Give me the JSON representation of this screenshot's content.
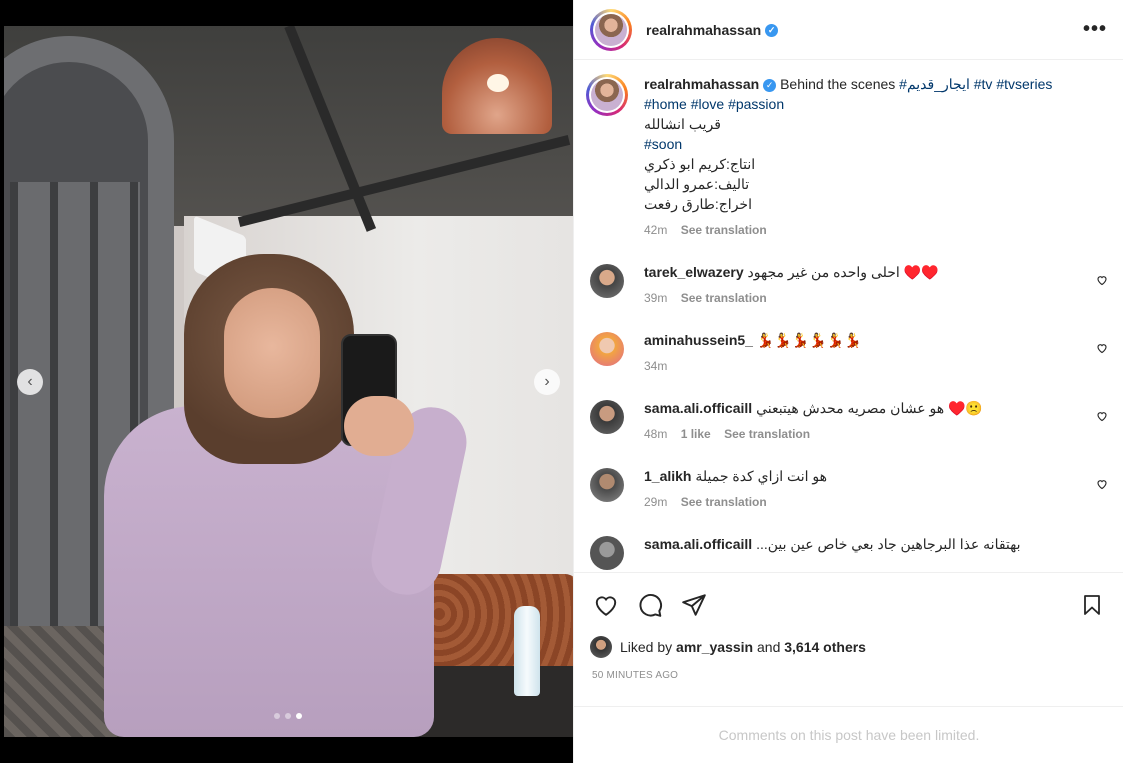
{
  "post": {
    "username": "realrahmahassan",
    "verified_mark": "✓",
    "more_icon": "•••",
    "carousel": {
      "prev": "‹",
      "next": "›",
      "count": 3,
      "active_index": 2
    }
  },
  "caption": {
    "username": "realrahmahassan",
    "text": "Behind the scenes",
    "tags_line1": [
      "#ايجار_قديم",
      "#tv",
      "#tvseries"
    ],
    "tags_line2": [
      "#home",
      "#love",
      "#passion"
    ],
    "line3": "قريب انشالله",
    "line4": "#soon",
    "line5": "انتاج:كريم ابو ذكري",
    "line6": "تاليف:عمرو الدالي",
    "line7": "اخراج:طارق رفعت",
    "time": "42m",
    "see_translation": "See translation"
  },
  "comments": [
    {
      "username": "tarek_elwazery",
      "text": "احلى واحده من غير مجهود ♥️♥️",
      "time": "39m",
      "likes": "",
      "see_translation": "See translation"
    },
    {
      "username": "aminahussein5_",
      "text": "💃💃💃💃💃💃",
      "time": "34m",
      "likes": "",
      "see_translation": ""
    },
    {
      "username": "sama.ali.officaill",
      "text": "هو عشان مصريه محدش هيتبعني ♥️🙁",
      "time": "48m",
      "likes": "1 like",
      "see_translation": "See translation"
    },
    {
      "username": "1_alikh",
      "text": "هو انت ازاي كدة جميلة",
      "time": "29m",
      "likes": "",
      "see_translation": "See translation"
    },
    {
      "username": "sama.ali.officaill",
      "text": "...بهتقانه عذا البرجاهين جاد بعي خاص عين بين",
      "time": "",
      "likes": "",
      "see_translation": ""
    }
  ],
  "likes": {
    "prefix": "Liked by",
    "user": "amr_yassin",
    "and": "and",
    "others": "3,614 others"
  },
  "timestamp": "50 MINUTES AGO",
  "comments_limited": "Comments on this post have been limited."
}
